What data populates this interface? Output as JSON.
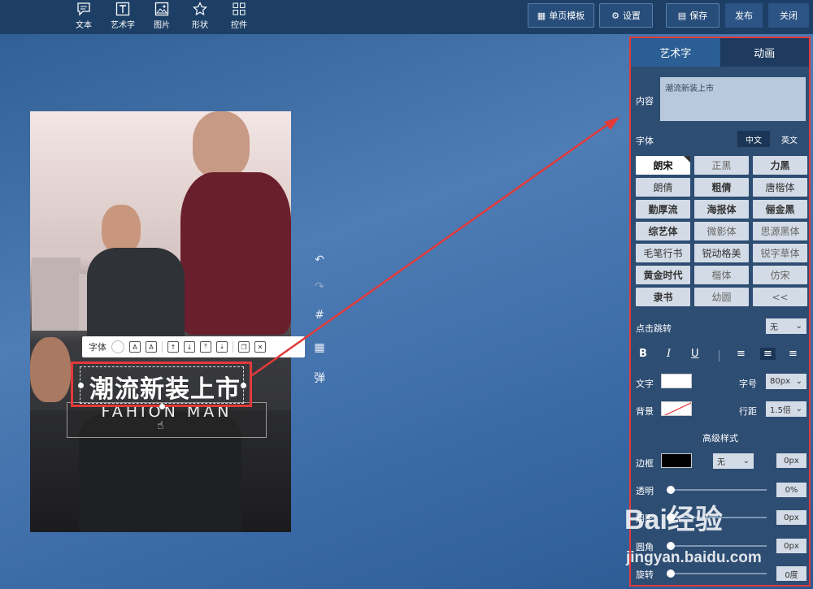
{
  "toolbar": {
    "tools": [
      {
        "label": "文本",
        "icon": "chat-icon"
      },
      {
        "label": "艺术字",
        "icon": "art-text-icon"
      },
      {
        "label": "图片",
        "icon": "image-icon"
      },
      {
        "label": "形状",
        "icon": "star-icon"
      },
      {
        "label": "控件",
        "icon": "grid-icon"
      }
    ],
    "template_label": "单页模板",
    "settings_label": "设置",
    "save_label": "保存",
    "publish_label": "发布",
    "close_label": "关闭"
  },
  "canvas": {
    "title_text": "潮流新装上市",
    "subtitle_text": "FAHION MAN"
  },
  "float_toolbar": {
    "font_label": "字体"
  },
  "side_tools": {
    "popup_label": "弹"
  },
  "panel": {
    "tabs": [
      "艺术字",
      "动画"
    ],
    "content_label": "内容",
    "content_value": "潮流新装上市",
    "font_label": "字体",
    "lang_tabs": [
      "中文",
      "英文"
    ],
    "fonts": [
      "朗宋",
      "正黑",
      "力黑",
      "朗倩",
      "粗倩",
      "唐楷体",
      "勤厚流",
      "海报体",
      "俪金黑",
      "综艺体",
      "微影体",
      "思源黑体",
      "毛笔行书",
      "锐动格美",
      "锐字草体",
      "黄金时代",
      "楷体",
      "仿宋",
      "隶书",
      "幼圆",
      "<<"
    ],
    "jump_label": "点击跳转",
    "jump_value": "无",
    "text_color_label": "文字",
    "font_size_label": "字号",
    "font_size_value": "80px",
    "bg_label": "背景",
    "line_height_label": "行距",
    "line_height_value": "1.5倍",
    "advanced_label": "高级样式",
    "border_label": "边框",
    "border_style": "无",
    "border_width": "0px",
    "opacity_label": "透明",
    "opacity_value": "0%",
    "shadow_label": "阴影",
    "shadow_value": "0px",
    "radius_label": "圆角",
    "radius_value": "0px",
    "rotate_label": "旋转",
    "rotate_value": "0度"
  },
  "watermark": {
    "brand": "Bai经验",
    "url": "jingyan.baidu.com"
  },
  "colors": {
    "highlight_red": "#e33a3a",
    "text_color": "#ffffff",
    "border_color": "#000000"
  }
}
